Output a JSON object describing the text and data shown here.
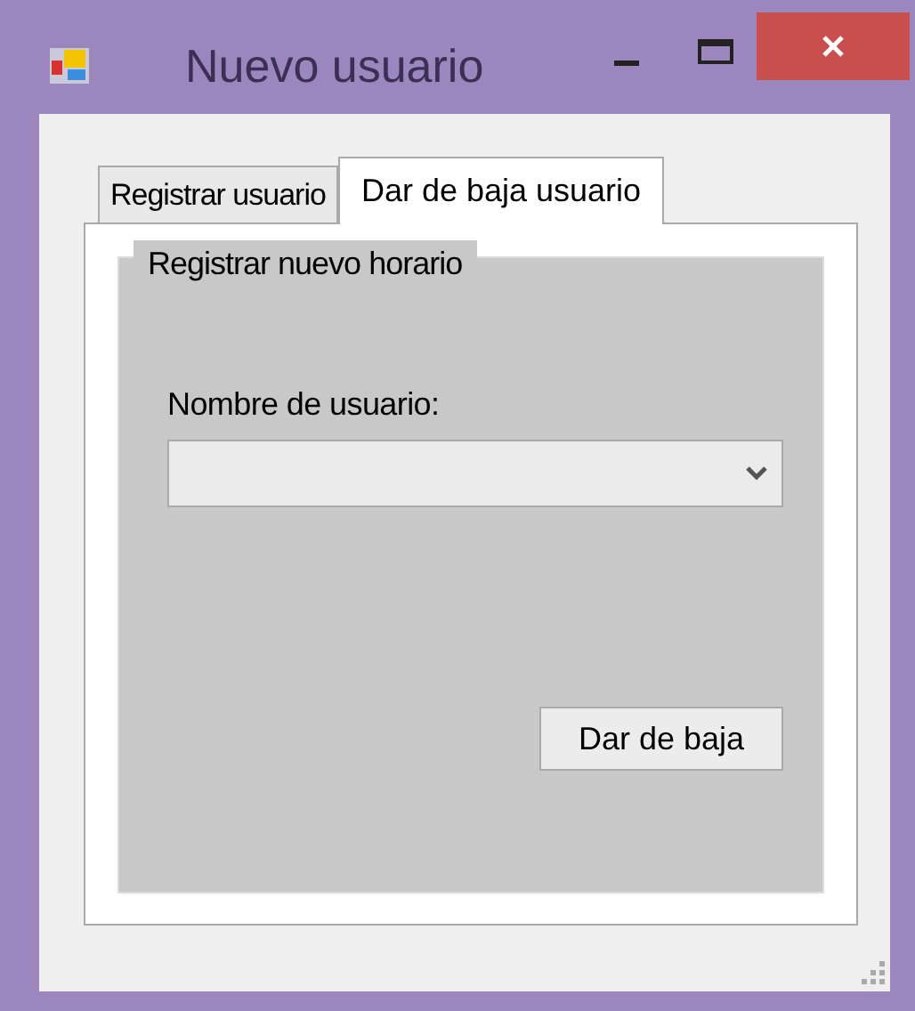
{
  "window": {
    "title": "Nuevo usuario"
  },
  "tabs": [
    {
      "label": "Registrar usuario",
      "selected": false
    },
    {
      "label": "Dar de baja usuario",
      "selected": true
    }
  ],
  "group": {
    "title": "Registrar nuevo horario",
    "field_label": "Nombre de usuario:",
    "button": "Dar de baja"
  }
}
